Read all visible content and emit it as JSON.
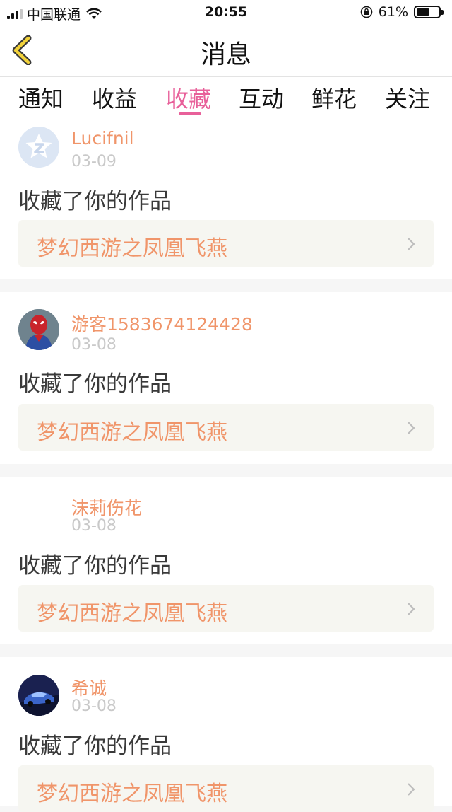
{
  "status_bar": {
    "carrier": "中国联通",
    "time": "20:55",
    "battery_percent": "61%",
    "battery_level": 0.61,
    "icons": [
      "signal-icon",
      "wifi-icon",
      "orientation-lock-icon",
      "battery-icon"
    ]
  },
  "nav": {
    "title": "消息",
    "back_icon": "chevron-left-icon"
  },
  "tabs": [
    {
      "label": "通知"
    },
    {
      "label": "收益"
    },
    {
      "label": "收藏",
      "active": true
    },
    {
      "label": "互动"
    },
    {
      "label": "鲜花"
    },
    {
      "label": "关注"
    }
  ],
  "colors": {
    "accent": "#e8609a",
    "username": "#f0956a",
    "date": "#c9c9c9",
    "link_bg": "#f6f6f1"
  },
  "messages": [
    {
      "username": "Lucifnil",
      "date": "03-09",
      "action": "收藏了你的作品",
      "work_title": "梦幻西游之凤凰飞燕",
      "avatar": "qq-default-avatar"
    },
    {
      "username": "游客1583674124428",
      "date": "03-08",
      "action": "收藏了你的作品",
      "work_title": "梦幻西游之凤凰飞燕",
      "avatar": "spiderman-avatar"
    },
    {
      "username": "沫莉伤花",
      "date": "03-08",
      "action": "收藏了你的作品",
      "work_title": "梦幻西游之凤凰飞燕",
      "avatar": "blank-avatar"
    },
    {
      "username": "希诚",
      "date": "03-08",
      "action": "收藏了你的作品",
      "work_title": "梦幻西游之凤凰飞燕",
      "avatar": "car-avatar"
    }
  ]
}
